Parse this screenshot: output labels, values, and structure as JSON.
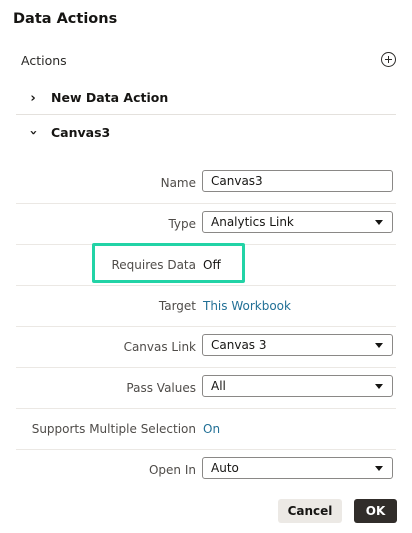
{
  "panel": {
    "title": "Data Actions"
  },
  "actions": {
    "label": "Actions",
    "add_icon": "plus-circle-icon"
  },
  "groups": [
    {
      "label": "New Data Action",
      "expanded": false,
      "icon": "chevron-right-icon"
    },
    {
      "label": "Canvas3",
      "expanded": true,
      "icon": "chevron-down-icon"
    }
  ],
  "properties": {
    "name": {
      "label": "Name",
      "value": "Canvas3"
    },
    "type": {
      "label": "Type",
      "value": "Analytics Link"
    },
    "requires_data": {
      "label": "Requires Data",
      "value": "Off"
    },
    "target": {
      "label": "Target",
      "value": "This Workbook"
    },
    "canvas_link": {
      "label": "Canvas Link",
      "value": "Canvas 3"
    },
    "pass_values": {
      "label": "Pass Values",
      "value": "All"
    },
    "supports_multiple_selection": {
      "label": "Supports Multiple Selection",
      "value": "On"
    },
    "open_in": {
      "label": "Open In",
      "value": "Auto"
    }
  },
  "footer": {
    "cancel_label": "Cancel",
    "ok_label": "OK"
  },
  "colors": {
    "highlight": "#22d3a6",
    "link": "#227096",
    "ok_button": "#312d2a"
  }
}
